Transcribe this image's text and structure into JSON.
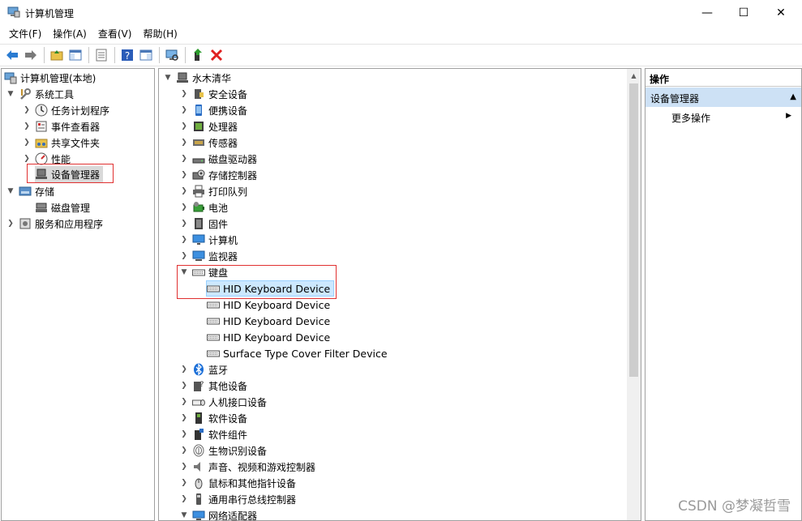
{
  "window": {
    "title": "计算机管理",
    "controls": {
      "minimize": "—",
      "maximize": "☐",
      "close": "✕"
    }
  },
  "menu": [
    "文件(F)",
    "操作(A)",
    "查看(V)",
    "帮助(H)"
  ],
  "left_tree": {
    "root": "计算机管理(本地)",
    "system_tools": "系统工具",
    "task_scheduler": "任务计划程序",
    "event_viewer": "事件查看器",
    "shared_folders": "共享文件夹",
    "performance": "性能",
    "device_manager": "设备管理器",
    "storage": "存储",
    "disk_management": "磁盘管理",
    "services_apps": "服务和应用程序"
  },
  "device_tree": {
    "root": "水木清华",
    "categories": [
      "安全设备",
      "便携设备",
      "处理器",
      "传感器",
      "磁盘驱动器",
      "存储控制器",
      "打印队列",
      "电池",
      "固件",
      "计算机",
      "监视器"
    ],
    "keyboard": {
      "label": "键盘",
      "children": [
        "HID Keyboard Device",
        "HID Keyboard Device",
        "HID Keyboard Device",
        "HID Keyboard Device",
        "Surface Type Cover Filter Device"
      ]
    },
    "more_categories": [
      "蓝牙",
      "其他设备",
      "人机接口设备",
      "软件设备",
      "软件组件",
      "生物识别设备",
      "声音、视频和游戏控制器",
      "鼠标和其他指针设备",
      "通用串行总线控制器",
      "网络适配器"
    ]
  },
  "actions": {
    "header": "操作",
    "section": "设备管理器",
    "more": "更多操作"
  },
  "watermark": "CSDN @梦凝哲雪",
  "colors": {
    "selection": "#cce8ff",
    "section_bg": "#cde1f5",
    "highlight_box": "#e03030"
  }
}
